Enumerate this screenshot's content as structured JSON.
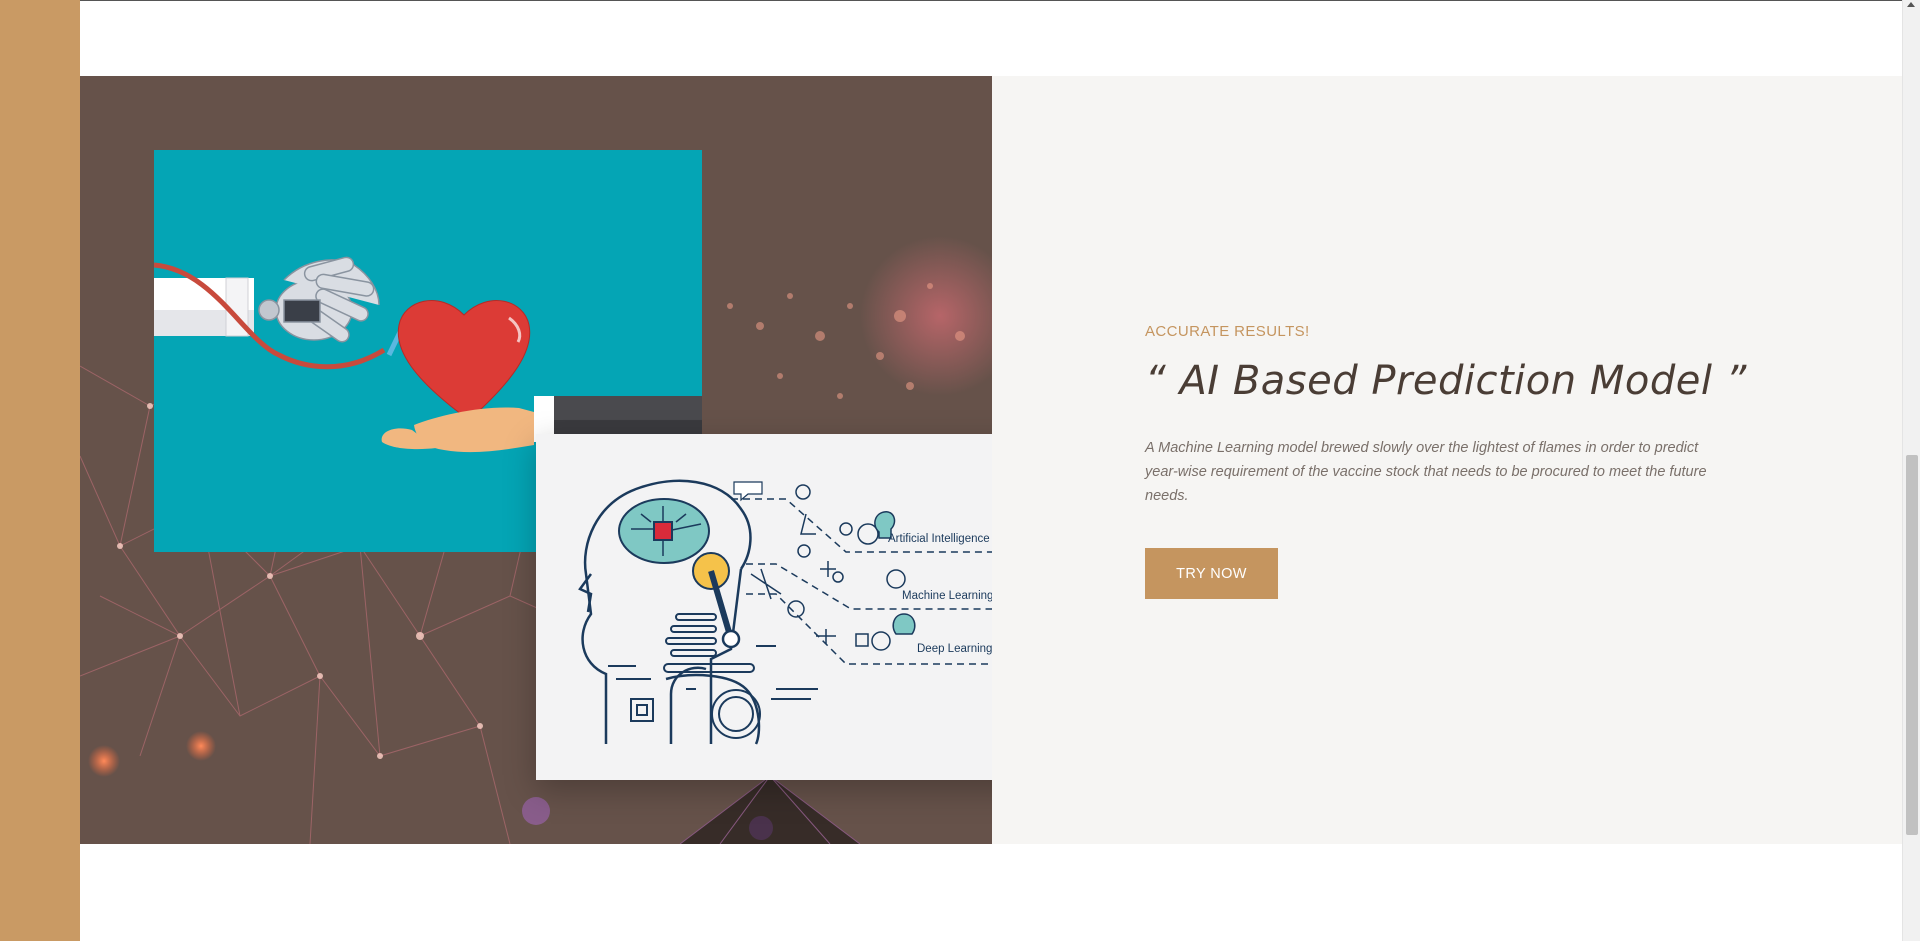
{
  "section": {
    "eyebrow": "ACCURATE RESULTS!",
    "headline": "“ AI Based Prediction Model ”",
    "description": "A Machine Learning model brewed slowly over the lightest of flames in order to predict year-wise requirement of the vaccine stock that needs to be procured to meet the future needs.",
    "cta_label": "TRY NOW"
  },
  "illustration": {
    "labels": [
      "Artificial Intelligence",
      "Machine Learning",
      "Deep Learning"
    ]
  },
  "colors": {
    "accent": "#c5955f",
    "left_bar": "#c99a64",
    "panel_dark": "#66524a",
    "panel_light": "#f6f5f3",
    "teal": "#04a5b5",
    "navy": "#1b3a5c"
  }
}
